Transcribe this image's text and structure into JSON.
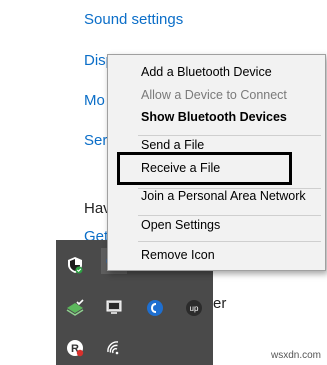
{
  "background": {
    "links": [
      "Sound settings",
      "Disp",
      "Mo",
      "Ser"
    ],
    "text_partial": "Hav",
    "link_partial": "Get",
    "tray_partial_text": "er"
  },
  "context_menu": {
    "items": [
      {
        "label": "Add a Bluetooth Device",
        "state": "normal"
      },
      {
        "label": "Allow a Device to Connect",
        "state": "disabled"
      },
      {
        "label": "Show Bluetooth Devices",
        "state": "bold"
      },
      {
        "label": "Send a File",
        "state": "normal"
      },
      {
        "label": "Receive a File",
        "state": "normal"
      },
      {
        "label": "Join a Personal Area Network",
        "state": "normal"
      },
      {
        "label": "Open Settings",
        "state": "normal"
      },
      {
        "label": "Remove Icon",
        "state": "normal"
      }
    ]
  },
  "tray": {
    "icons": [
      "windows-defender-icon",
      "bluetooth-icon",
      "volume-muted-icon",
      "defender-check-icon",
      "display-icon",
      "blue-circle-app-icon",
      "upwork-icon",
      "r-app-icon",
      "wifi-icon"
    ],
    "upwork_label": "up",
    "r_label": "R"
  },
  "watermark": "wsxdn.com",
  "colors": {
    "link": "#0b6ec8",
    "tray_bg": "#4a4a4a",
    "menu_bg": "#f2f2f2"
  }
}
